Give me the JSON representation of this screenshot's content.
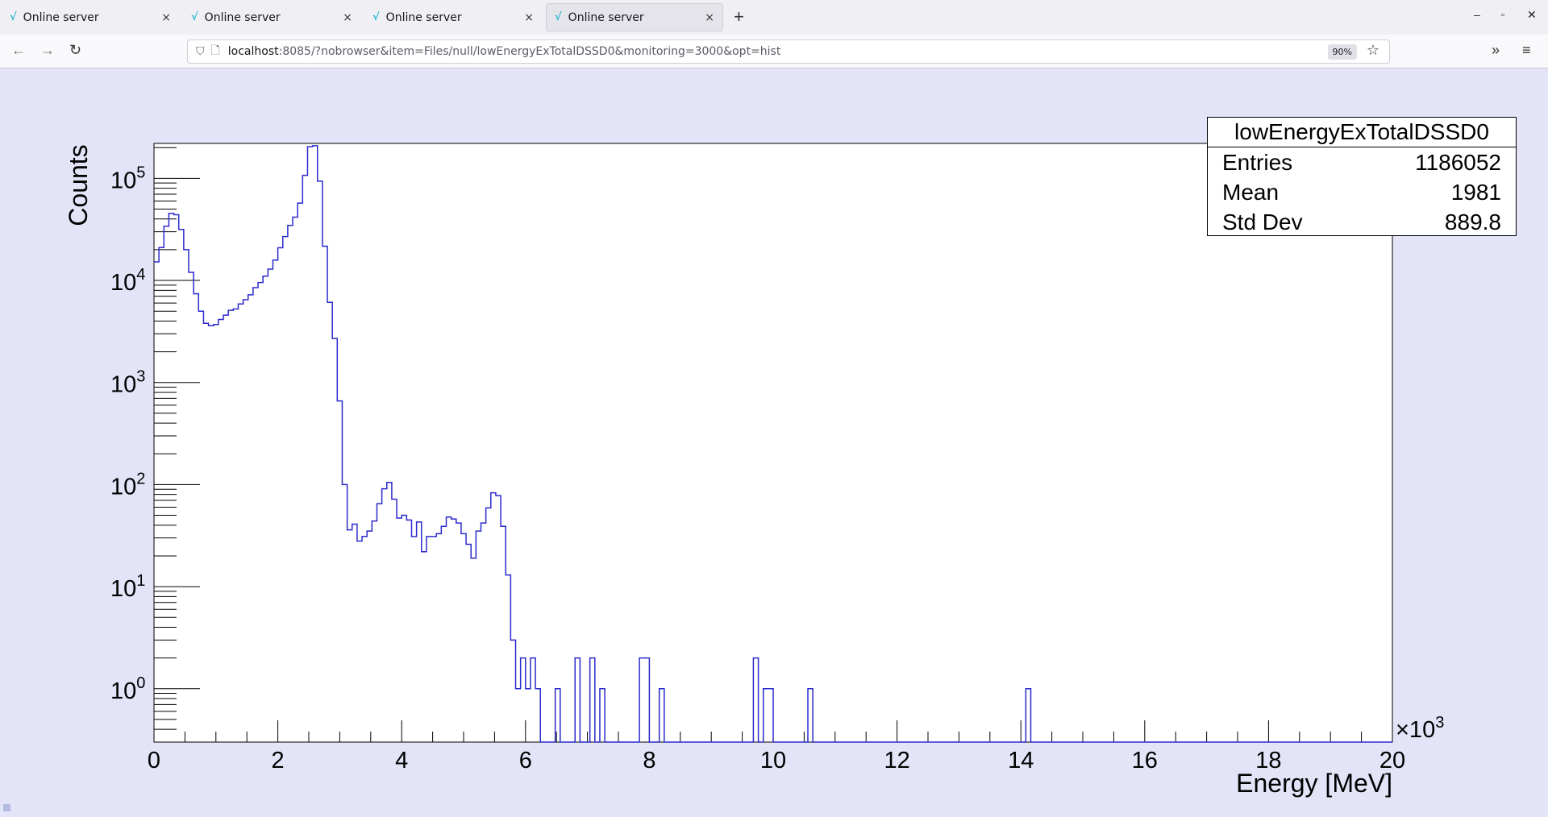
{
  "browser": {
    "tabs": [
      {
        "label": "Online server",
        "active": false
      },
      {
        "label": "Online server",
        "active": false
      },
      {
        "label": "Online server",
        "active": false
      },
      {
        "label": "Online server",
        "active": true
      }
    ],
    "url_host": "localhost",
    "url_rest": ":8085/?nobrowser&item=Files/null/lowEnergyExTotalDSSD0&monitoring=3000&opt=hist",
    "zoom": "90%",
    "icons": {
      "new_tab": "+",
      "close": "×",
      "back": "←",
      "forward": "→",
      "reload": "↻",
      "overflow": "»",
      "menu": "≡",
      "star": "☆"
    }
  },
  "stats": {
    "title": "lowEnergyExTotalDSSD0",
    "rows": [
      {
        "label": "Entries",
        "value": "1186052"
      },
      {
        "label": "Mean",
        "value": "1981"
      },
      {
        "label": "Std Dev",
        "value": "889.8"
      }
    ]
  },
  "chart_data": {
    "type": "histogram",
    "title": "lowEnergyExTotalDSSD0",
    "xlabel": "Energy [MeV]",
    "ylabel": "Counts",
    "x_multiplier_label": "×10",
    "x_multiplier_exp": "3",
    "xlim": [
      0,
      20000
    ],
    "ylim": [
      0.3,
      220000
    ],
    "yscale": "log",
    "x_ticks": [
      "0",
      "2",
      "4",
      "6",
      "8",
      "10",
      "12",
      "14",
      "16",
      "18",
      "20"
    ],
    "y_ticks": [
      {
        "base": "10",
        "exp": "0"
      },
      {
        "base": "10",
        "exp": "1"
      },
      {
        "base": "10",
        "exp": "2"
      },
      {
        "base": "10",
        "exp": "3"
      },
      {
        "base": "10",
        "exp": "4"
      },
      {
        "base": "10",
        "exp": "5"
      }
    ],
    "bin_width": 80,
    "nbins": 250,
    "counts": [
      15200,
      21000,
      34000,
      45500,
      44000,
      31600,
      20000,
      12000,
      7400,
      5000,
      3800,
      3600,
      3700,
      4150,
      4570,
      5100,
      5250,
      5880,
      6470,
      7230,
      8500,
      9550,
      11000,
      12900,
      15800,
      20900,
      26900,
      34600,
      41700,
      57200,
      107000,
      204000,
      209000,
      93800,
      21600,
      6100,
      2700,
      660,
      100,
      36,
      41,
      28,
      31,
      35,
      44,
      65,
      91,
      105,
      72,
      47,
      50,
      45,
      31,
      43,
      22,
      31,
      31,
      33,
      39,
      48,
      46,
      42,
      33,
      26,
      19,
      35,
      42,
      59,
      83,
      78,
      39,
      13,
      3,
      1,
      2,
      1,
      2,
      1
    ],
    "sparse_bins": [
      [
        81,
        1
      ],
      [
        85,
        2
      ],
      [
        88,
        2
      ],
      [
        90,
        1
      ],
      [
        98,
        2
      ],
      [
        99,
        2
      ],
      [
        102,
        1
      ],
      [
        121,
        2
      ],
      [
        123,
        1
      ],
      [
        124,
        1
      ],
      [
        132,
        1
      ],
      [
        176,
        1
      ]
    ],
    "line_color": "#2a2acc"
  }
}
